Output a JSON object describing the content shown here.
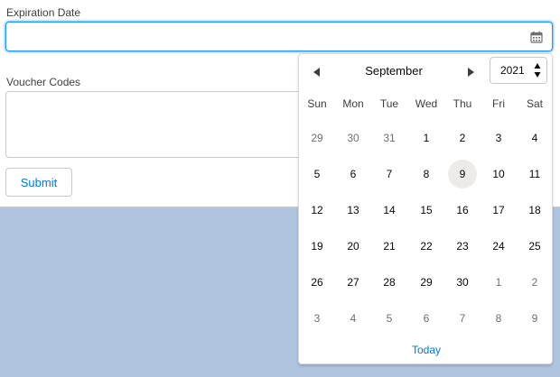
{
  "form": {
    "expiration_label": "Expiration Date",
    "expiration_value": "",
    "voucher_label": "Voucher Codes",
    "voucher_value": "",
    "submit_label": "Submit",
    "calendar_icon": "calendar-icon"
  },
  "datepicker": {
    "month": "September",
    "year": "2021",
    "prev_icon": "triangle-left-icon",
    "next_icon": "triangle-right-icon",
    "weekdays": [
      "Sun",
      "Mon",
      "Tue",
      "Wed",
      "Thu",
      "Fri",
      "Sat"
    ],
    "weeks": [
      [
        {
          "d": "29",
          "o": true
        },
        {
          "d": "30",
          "o": true
        },
        {
          "d": "31",
          "o": true
        },
        {
          "d": "1"
        },
        {
          "d": "2"
        },
        {
          "d": "3"
        },
        {
          "d": "4"
        }
      ],
      [
        {
          "d": "5"
        },
        {
          "d": "6"
        },
        {
          "d": "7"
        },
        {
          "d": "8"
        },
        {
          "d": "9",
          "today": true
        },
        {
          "d": "10"
        },
        {
          "d": "11"
        }
      ],
      [
        {
          "d": "12"
        },
        {
          "d": "13"
        },
        {
          "d": "14"
        },
        {
          "d": "15"
        },
        {
          "d": "16"
        },
        {
          "d": "17"
        },
        {
          "d": "18"
        }
      ],
      [
        {
          "d": "19"
        },
        {
          "d": "20"
        },
        {
          "d": "21"
        },
        {
          "d": "22"
        },
        {
          "d": "23"
        },
        {
          "d": "24"
        },
        {
          "d": "25"
        }
      ],
      [
        {
          "d": "26"
        },
        {
          "d": "27"
        },
        {
          "d": "28"
        },
        {
          "d": "29"
        },
        {
          "d": "30"
        },
        {
          "d": "1",
          "o": true
        },
        {
          "d": "2",
          "o": true
        }
      ],
      [
        {
          "d": "3",
          "o": true
        },
        {
          "d": "4",
          "o": true
        },
        {
          "d": "5",
          "o": true
        },
        {
          "d": "6",
          "o": true
        },
        {
          "d": "7",
          "o": true
        },
        {
          "d": "8",
          "o": true
        },
        {
          "d": "9",
          "o": true
        }
      ]
    ],
    "today_label": "Today"
  },
  "colors": {
    "accent": "#0176d3",
    "focus_border": "#1b96ff",
    "backdrop": "#b0c4df",
    "today_bg": "#ecebea"
  }
}
